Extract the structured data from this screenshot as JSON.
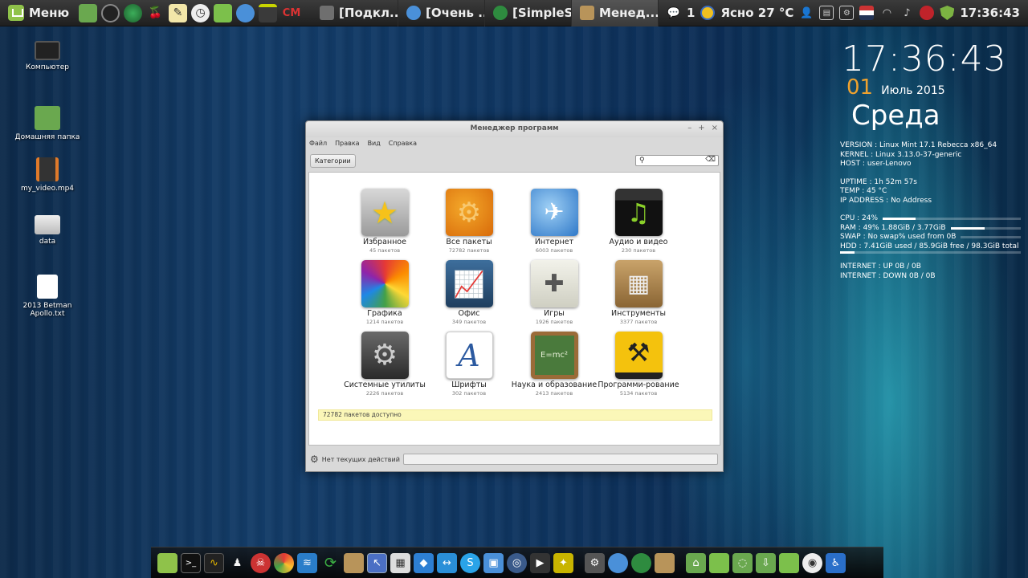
{
  "top_panel": {
    "menu_label": "Меню",
    "tasks": [
      {
        "label": "[Подкл...",
        "color": "#6f6f6f",
        "active": false
      },
      {
        "label": "[Очень ...",
        "color": "#4a90d9",
        "active": false
      },
      {
        "label": "[SimpleS...",
        "color": "#2e8b3f",
        "active": false
      },
      {
        "label": "Менед...",
        "color": "#b8945a",
        "active": true
      }
    ],
    "notifications_count": "1",
    "weather": "Ясно 27 °C",
    "clock": "17:36:43"
  },
  "desktop_icons": [
    {
      "label": "Компьютер",
      "icon": "computer-icon"
    },
    {
      "label": "Домашняя папка",
      "icon": "home-folder-icon"
    },
    {
      "label": "my_video.mp4",
      "icon": "video-file-icon"
    },
    {
      "label": "data",
      "icon": "drive-icon"
    },
    {
      "label": "2013 Betman Apollo.txt",
      "icon": "text-file-icon"
    }
  ],
  "conky": {
    "time": "17:36:43",
    "day": "01",
    "month_year": "Июль 2015",
    "weekday": "Среда",
    "version": "VERSION : Linux Mint 17.1 Rebecca x86_64",
    "kernel": "KERNEL  : Linux 3.13.0-37-generic",
    "host": "HOST     : user-Lenovo",
    "uptime": "UPTIME      : 1h 52m 57s",
    "temp": "TEMP         : 45  °C",
    "ip": "IP ADDRESS : No Address",
    "cpu": "CPU   : 24%",
    "cpu_level": 0.24,
    "ram": "RAM   : 49% 1.88GiB / 3.77GiB",
    "ram_level": 0.49,
    "swap": "SWAP : No swap% used from 0B",
    "swap_level": 0,
    "hdd": "HDD   : 7.41GiB used / 85.9GiB free / 98.3GiB total",
    "hdd_level": 0.08,
    "net_up": "INTERNET : UP 0B      / 0B",
    "net_down": "INTERNET : DOWN 0B      / 0B"
  },
  "window": {
    "title": "Менеджер программ",
    "menu": [
      "Файл",
      "Правка",
      "Вид",
      "Справка"
    ],
    "categories_button": "Категории",
    "search_placeholder": "",
    "categories": [
      {
        "name": "Избранное",
        "count": "45 пакетов",
        "icon": "star-icon"
      },
      {
        "name": "Все пакеты",
        "count": "72782 пакетов",
        "icon": "gears-icon"
      },
      {
        "name": "Интернет",
        "count": "6003 пакетов",
        "icon": "globe-icon"
      },
      {
        "name": "Аудио и видео",
        "count": "230 пакетов",
        "icon": "clapperboard-icon"
      },
      {
        "name": "Графика",
        "count": "1214 пакетов",
        "icon": "color-wheel-icon"
      },
      {
        "name": "Офис",
        "count": "349 пакетов",
        "icon": "chart-icon"
      },
      {
        "name": "Игры",
        "count": "1926 пакетов",
        "icon": "gamepad-icon"
      },
      {
        "name": "Инструменты",
        "count": "3377 пакетов",
        "icon": "calculator-icon"
      },
      {
        "name": "Системные утилиты",
        "count": "2226 пакетов",
        "icon": "system-gear-icon"
      },
      {
        "name": "Шрифты",
        "count": "302 пакетов",
        "icon": "font-icon"
      },
      {
        "name": "Наука и образование",
        "count": "2413 пакетов",
        "icon": "chalkboard-icon"
      },
      {
        "name": "Программи-рование",
        "count": "5134 пакетов",
        "icon": "construction-icon"
      }
    ],
    "available_notice": "72782 пакетов доступно",
    "status_text": "Нет текущих действий"
  }
}
